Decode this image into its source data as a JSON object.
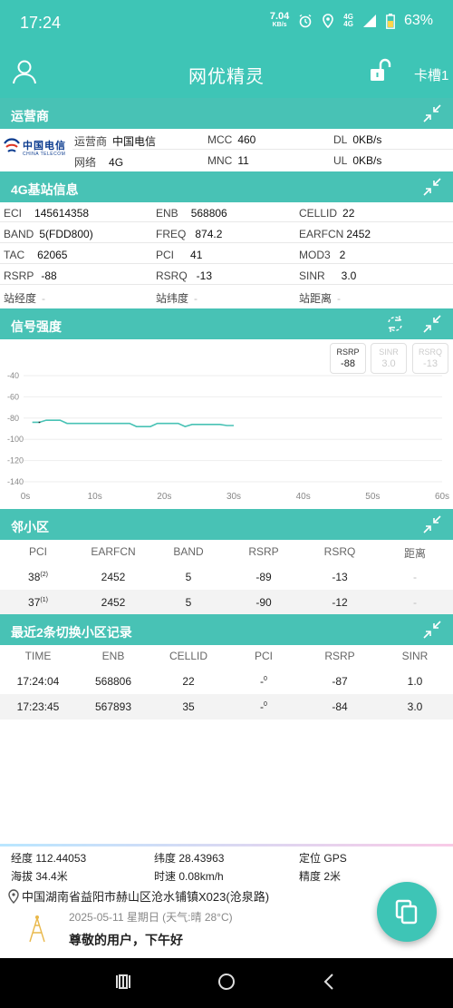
{
  "status": {
    "time": "17:24",
    "net_speed": "7.04",
    "net_unit": "KB/s",
    "net_type_top": "4G",
    "net_type_bottom": "4G",
    "battery": "63%"
  },
  "app": {
    "title": "网优精灵",
    "slot": "卡槽1"
  },
  "operator": {
    "header": "运营商",
    "logo_cn": "中国电信",
    "logo_en": "CHINA TELECOM",
    "carrier_label": "运营商",
    "carrier_value": "中国电信",
    "net_label": "网络",
    "net_value": "4G",
    "mcc_label": "MCC",
    "mcc_value": "460",
    "mnc_label": "MNC",
    "mnc_value": "11",
    "dl_label": "DL",
    "dl_value": "0KB/s",
    "ul_label": "UL",
    "ul_value": "0KB/s"
  },
  "cell": {
    "header": "4G基站信息",
    "eci_label": "ECI",
    "eci": "145614358",
    "enb_label": "ENB",
    "enb": "568806",
    "cellid_label": "CELLID",
    "cellid": "22",
    "band_label": "BAND",
    "band": "5(FDD800)",
    "freq_label": "FREQ",
    "freq": "874.2",
    "earfcn_label": "EARFCN",
    "earfcn": "2452",
    "tac_label": "TAC",
    "tac": "62065",
    "pci_label": "PCI",
    "pci": "41",
    "mod3_label": "MOD3",
    "mod3": "2",
    "rsrp_label": "RSRP",
    "rsrp": "-88",
    "rsrq_label": "RSRQ",
    "rsrq": "-13",
    "sinr_label": "SINR",
    "sinr": "3.0",
    "lon_label": "站经度",
    "lon": "-",
    "lat_label": "站纬度",
    "lat": "-",
    "dist_label": "站距离",
    "dist": "-"
  },
  "signal": {
    "header": "信号强度",
    "legend": [
      {
        "label": "RSRP",
        "value": "-88",
        "active": true
      },
      {
        "label": "SINR",
        "value": "3.0",
        "active": false
      },
      {
        "label": "RSRQ",
        "value": "-13",
        "active": false
      }
    ]
  },
  "chart_data": {
    "type": "line",
    "title": "",
    "xlabel": "",
    "ylabel": "",
    "x_ticks": [
      "0s",
      "10s",
      "20s",
      "30s",
      "40s",
      "50s",
      "60s"
    ],
    "y_ticks": [
      "-40",
      "-60",
      "-80",
      "-100",
      "-120",
      "-140"
    ],
    "xlim": [
      0,
      60
    ],
    "ylim": [
      -140,
      -40
    ],
    "series": [
      {
        "x": [
          1,
          2,
          3,
          4,
          5,
          6,
          7,
          8,
          9,
          10,
          11,
          12,
          13,
          14,
          15,
          16,
          17,
          18,
          19,
          20,
          21,
          22,
          23,
          24,
          25,
          26,
          27,
          28,
          29,
          30
        ],
        "y": [
          -84,
          -84,
          -82,
          -82,
          -82,
          -85,
          -85,
          -85,
          -85,
          -85,
          -85,
          -85,
          -85,
          -85,
          -85,
          -88,
          -88,
          -88,
          -85,
          -85,
          -85,
          -85,
          -88,
          -86,
          -86,
          -86,
          -86,
          -86,
          -87,
          -87
        ],
        "color": "#48c2b5"
      }
    ]
  },
  "neighbors": {
    "header": "邻小区",
    "columns": [
      "PCI",
      "EARFCN",
      "BAND",
      "RSRP",
      "RSRQ",
      "距离"
    ],
    "rows": [
      {
        "pci": "38",
        "sup": "(2)",
        "earfcn": "2452",
        "band": "5",
        "rsrp": "-89",
        "rsrq": "-13",
        "dist": "-"
      },
      {
        "pci": "37",
        "sup": "(1)",
        "earfcn": "2452",
        "band": "5",
        "rsrp": "-90",
        "rsrq": "-12",
        "dist": "-"
      }
    ]
  },
  "handover": {
    "header": "最近2条切换小区记录",
    "columns": [
      "TIME",
      "ENB",
      "CELLID",
      "PCI",
      "RSRP",
      "SINR"
    ],
    "rows": [
      {
        "time": "17:24:04",
        "enb": "568806",
        "cellid": "22",
        "pci": "-",
        "sup": "0",
        "rsrp": "-87",
        "sinr": "1.0"
      },
      {
        "time": "17:23:45",
        "enb": "567893",
        "cellid": "35",
        "pci": "-",
        "sup": "0",
        "rsrp": "-84",
        "sinr": "3.0"
      }
    ]
  },
  "location": {
    "lon_label": "经度",
    "lon": "112.44053",
    "lat_label": "纬度",
    "lat": "28.43963",
    "mode_label": "定位",
    "mode": "GPS",
    "alt_label": "海拔",
    "alt": "34.4米",
    "speed_label": "时速",
    "speed": "0.08km/h",
    "acc_label": "精度",
    "acc": "2米",
    "address": "中国湖南省益阳市赫山区沧水铺镇X023(沧泉路)",
    "date": "2025-05-11   星期日 (天气:晴 28°C)",
    "greeting": "尊敬的用户，下午好"
  }
}
